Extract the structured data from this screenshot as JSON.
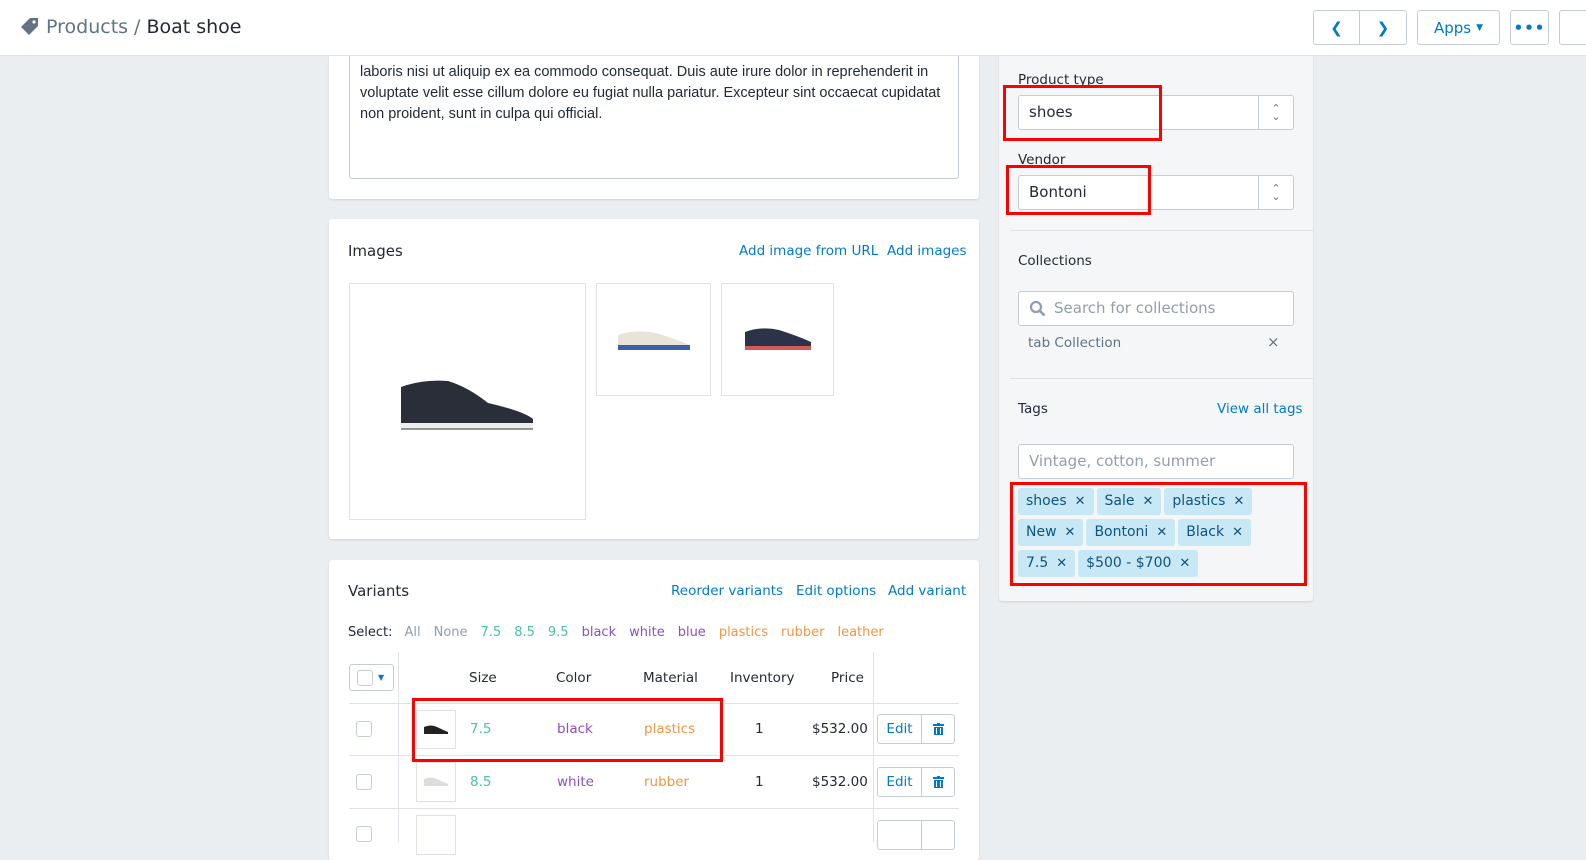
{
  "header": {
    "breadcrumb_parent": "Products",
    "separator": "/",
    "title": "Boat shoe",
    "apps_label": "Apps"
  },
  "description": {
    "text": "laboris nisi ut aliquip ex ea commodo consequat. Duis aute irure dolor in reprehenderit in voluptate velit esse cillum dolore eu fugiat nulla pariatur. Excepteur sint occaecat cupidatat non proident, sunt in culpa qui official."
  },
  "images": {
    "title": "Images",
    "add_url": "Add image from URL",
    "add_images": "Add images"
  },
  "variants": {
    "title": "Variants",
    "reorder": "Reorder variants",
    "edit_options": "Edit options",
    "add_variant": "Add variant",
    "select_label": "Select:",
    "select_options": [
      "All",
      "None",
      "7.5",
      "8.5",
      "9.5",
      "black",
      "white",
      "blue",
      "plastics",
      "rubber",
      "leather"
    ],
    "columns": [
      "Size",
      "Color",
      "Material",
      "Inventory",
      "Price"
    ],
    "rows": [
      {
        "size": "7.5",
        "color": "black",
        "material": "plastics",
        "inventory": "1",
        "price": "$532.00"
      },
      {
        "size": "8.5",
        "color": "white",
        "material": "rubber",
        "inventory": "1",
        "price": "$532.00"
      }
    ],
    "edit_label": "Edit"
  },
  "organization": {
    "product_type_label": "Product type",
    "product_type": "shoes",
    "vendor_label": "Vendor",
    "vendor": "Bontoni",
    "collections_label": "Collections",
    "collections_placeholder": "Search for collections",
    "collection_item": "tab Collection",
    "tags_label": "Tags",
    "view_all_tags": "View all tags",
    "tags_placeholder": "Vintage, cotton, summer",
    "tags": [
      "shoes",
      "Sale",
      "plastics",
      "New",
      "Bontoni",
      "Black",
      "7.5",
      "$500 - $700"
    ]
  },
  "colors": {
    "link": "#007ace",
    "size": "#47c1a8",
    "color": "#8a4fc7",
    "material": "#f49342",
    "highlight": "#ff0000"
  }
}
